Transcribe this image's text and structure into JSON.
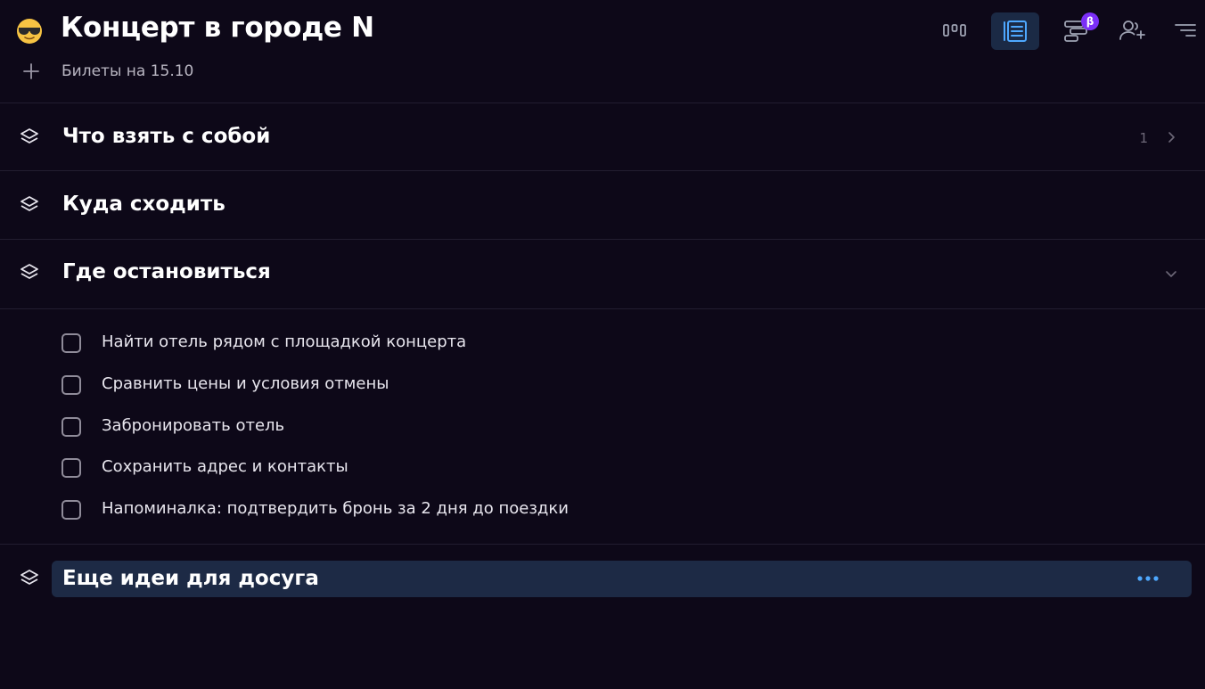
{
  "header": {
    "emoji": "😎",
    "title": "Концерт в городе N",
    "subtitle": "Билеты на 15.10"
  },
  "toolbar": {
    "items": [
      {
        "icon": "board-view-icon",
        "active": false
      },
      {
        "icon": "list-view-icon",
        "active": true
      },
      {
        "icon": "timeline-view-icon",
        "active": false,
        "badge": "β"
      },
      {
        "icon": "add-user-icon",
        "active": false
      },
      {
        "icon": "menu-icon",
        "active": false
      }
    ],
    "accent": "#4ea8ff",
    "badge_color": "#7b2ff7"
  },
  "sections": [
    {
      "title": "Что взять с собой",
      "count": "1",
      "state": "collapsed"
    },
    {
      "title": "Куда сходить",
      "count": "",
      "state": "none"
    },
    {
      "title": "Где остановиться",
      "count": "",
      "state": "expanded"
    },
    {
      "title": "Еще идеи для досуга",
      "count": "",
      "state": "editing"
    }
  ],
  "tasks": [
    {
      "label": "Найти отель рядом с площадкой концерта",
      "checked": false
    },
    {
      "label": "Сравнить цены и условия отмены",
      "checked": false
    },
    {
      "label": "Забронировать отель",
      "checked": false
    },
    {
      "label": "Сохранить адрес и контакты",
      "checked": false
    },
    {
      "label": "Напоминалка: подтвердить бронь за 2 дня до поездки",
      "checked": false
    }
  ]
}
